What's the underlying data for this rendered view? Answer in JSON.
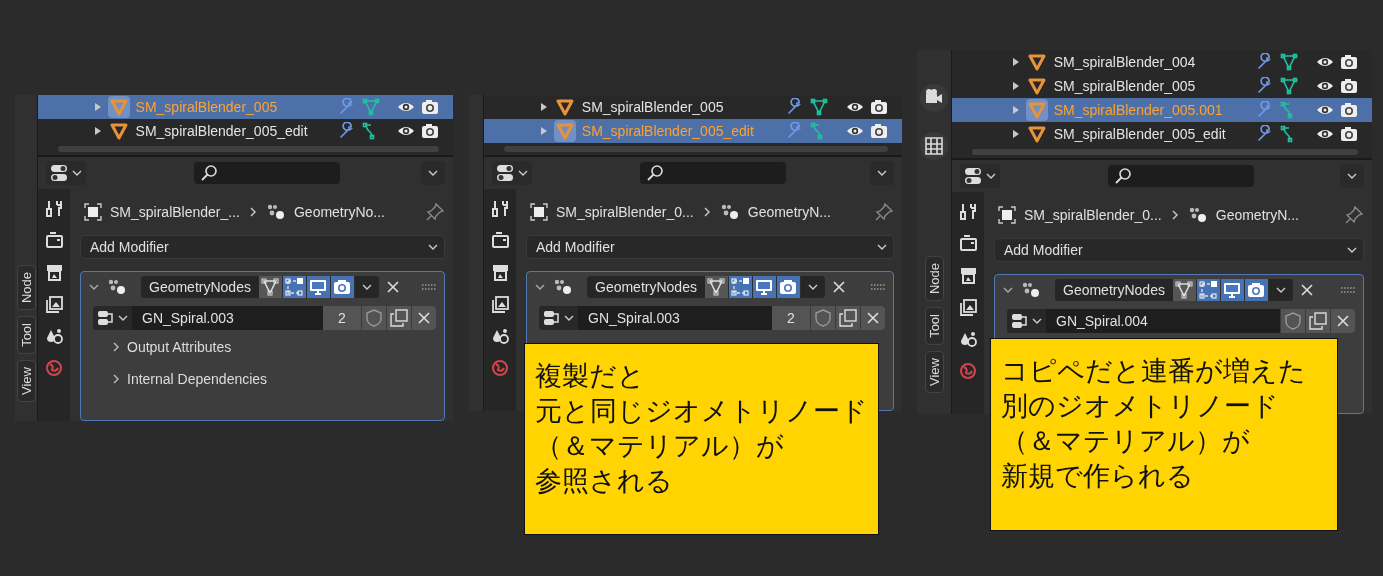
{
  "panels": [
    {
      "side_tabs": [
        {
          "label": "Node"
        },
        {
          "label": "Tool"
        },
        {
          "label": "View"
        }
      ],
      "outliner_rows": [
        {
          "name": "SM_spiralBlender_005",
          "selected": true,
          "kind": "mesh"
        },
        {
          "name": "SM_spiralBlender_005_edit",
          "selected": false,
          "kind": "curve"
        }
      ],
      "breadcrumb": {
        "object": "SM_spiralBlender_...",
        "modifier": "GeometryNo..."
      },
      "add_modifier": "Add Modifier",
      "modifier": {
        "name": "GeometryNodes",
        "expanded": true,
        "toggles": [
          {
            "kind": "cage",
            "on": false
          },
          {
            "kind": "edit",
            "on": true
          },
          {
            "kind": "viewport",
            "on": true
          },
          {
            "kind": "render",
            "on": true
          }
        ]
      },
      "node_group": {
        "name": "GN_Spiral.003",
        "users": "2"
      },
      "subpanels": [
        {
          "label": "Output Attributes",
          "expanded": false
        },
        {
          "label": "Internal Dependencies",
          "expanded": false
        }
      ]
    },
    {
      "outliner_rows": [
        {
          "name": "SM_spiralBlender_005",
          "selected": false,
          "kind": "mesh"
        },
        {
          "name": "SM_spiralBlender_005_edit",
          "selected": true,
          "kind": "curve"
        }
      ],
      "breadcrumb": {
        "object": "SM_spiralBlender_0...",
        "modifier": "GeometryN..."
      },
      "add_modifier": "Add Modifier",
      "modifier": {
        "name": "GeometryNodes",
        "expanded": true,
        "toggles": [
          {
            "kind": "cage",
            "on": false
          },
          {
            "kind": "edit",
            "on": true
          },
          {
            "kind": "viewport",
            "on": true
          },
          {
            "kind": "render",
            "on": true
          }
        ]
      },
      "node_group": {
        "name": "GN_Spiral.003",
        "users": "2"
      }
    },
    {
      "side_tabs": [
        {
          "label": "Node"
        },
        {
          "label": "Tool"
        },
        {
          "label": "View"
        }
      ],
      "viewport_buttons": [
        {
          "kind": "camera"
        },
        {
          "kind": "grid"
        }
      ],
      "outliner_rows": [
        {
          "name": "SM_spiralBlender_004",
          "selected": false,
          "kind": "mesh"
        },
        {
          "name": "SM_spiralBlender_005",
          "selected": false,
          "kind": "mesh"
        },
        {
          "name": "SM_spiralBlender_005.001",
          "selected": true,
          "kind": "curve"
        },
        {
          "name": "SM_spiralBlender_005_edit",
          "selected": false,
          "kind": "curve"
        }
      ],
      "breadcrumb": {
        "object": "SM_spiralBlender_0...",
        "modifier": "GeometryN..."
      },
      "add_modifier": "Add Modifier",
      "modifier": {
        "name": "GeometryNodes",
        "expanded": true,
        "toggles": [
          {
            "kind": "cage",
            "on": false
          },
          {
            "kind": "edit",
            "on": true
          },
          {
            "kind": "viewport",
            "on": true
          },
          {
            "kind": "render",
            "on": true
          }
        ]
      },
      "node_group": {
        "name": "GN_Spiral.004"
      }
    }
  ],
  "captions": [
    {
      "lines": [
        "複製だと",
        "元と同じジオメトリノード",
        "（＆マテリアル）が",
        "参照される"
      ]
    },
    {
      "lines": [
        "コピペだと連番が増えた",
        "別のジオメトリノード",
        "（＆マテリアル）が",
        "新規で作られる"
      ]
    }
  ]
}
